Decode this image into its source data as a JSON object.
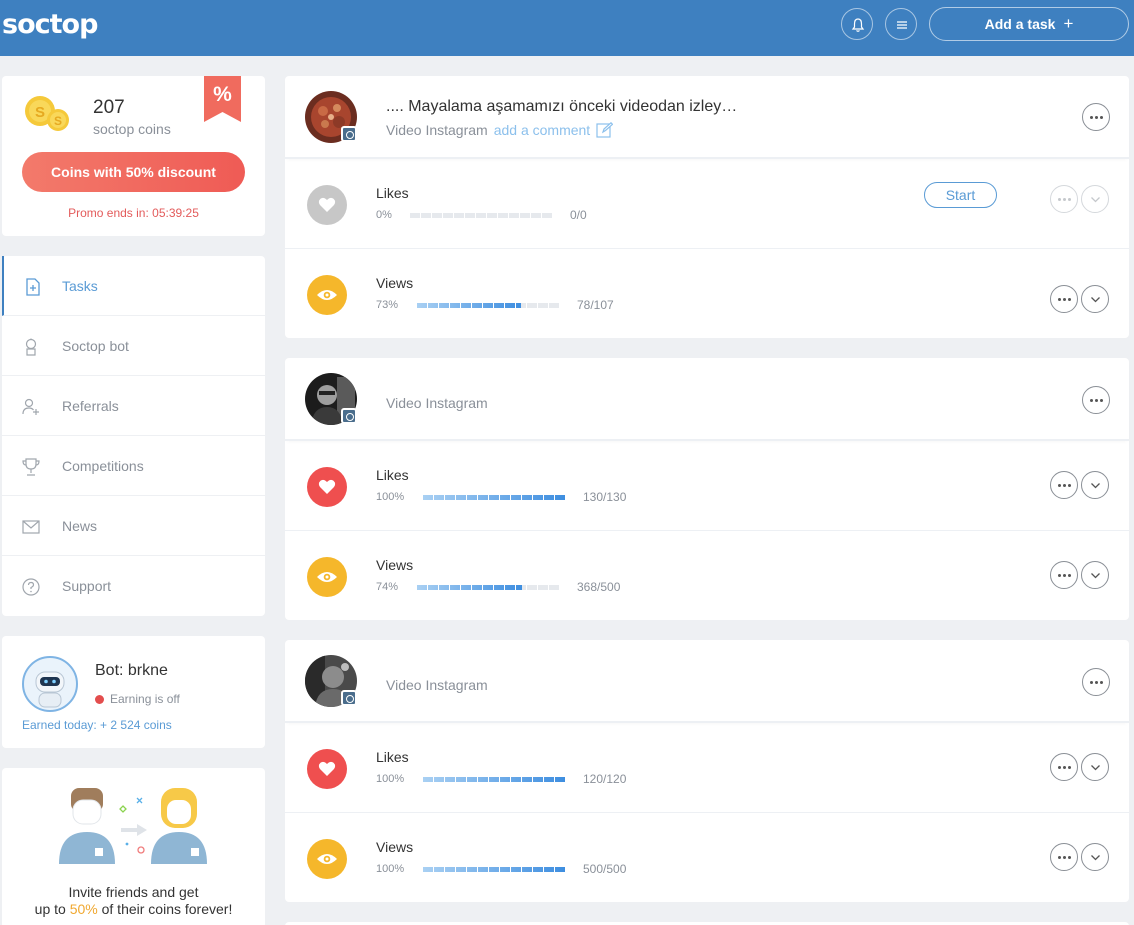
{
  "header": {
    "logo": "soctop",
    "add_task_label": "Add a task",
    "add_task_icon": "+"
  },
  "coins": {
    "count": "207",
    "label": "soctop coins",
    "badge": "%",
    "discount_button": "Coins with 50% discount",
    "promo_text": "Promo ends in: 05:39:25"
  },
  "nav": {
    "items": [
      {
        "label": "Tasks",
        "icon": "task-icon",
        "active": true
      },
      {
        "label": "Soctop bot",
        "icon": "robot-icon"
      },
      {
        "label": "Referrals",
        "icon": "user-add-icon"
      },
      {
        "label": "Competitions",
        "icon": "trophy-icon"
      },
      {
        "label": "News",
        "icon": "mail-icon"
      },
      {
        "label": "Support",
        "icon": "help-icon"
      }
    ]
  },
  "bot": {
    "name": "Bot: brkne",
    "status": "Earning is off",
    "earned": "Earned today: + 2 524 coins"
  },
  "invite": {
    "line1": "Invite friends and get",
    "line2_pre": "up to ",
    "line2_hl": "50%",
    "line2_post": " of their coins forever!"
  },
  "tasks": [
    {
      "title": ".... Mayalama aşamamızı önceki videodan izley…",
      "type": "Video Instagram",
      "comment_link": "add a comment",
      "stats": [
        {
          "label": "Likes",
          "percent_text": "0%",
          "progress": 0,
          "count": "0/0",
          "action": "Start"
        },
        {
          "label": "Views",
          "percent_text": "73%",
          "progress": 0.73,
          "count": "78/107"
        }
      ]
    },
    {
      "title": "",
      "type": "Video Instagram",
      "stats": [
        {
          "label": "Likes",
          "percent_text": "100%",
          "progress": 1.0,
          "count": "130/130"
        },
        {
          "label": "Views",
          "percent_text": "74%",
          "progress": 0.74,
          "count": "368/500"
        }
      ]
    },
    {
      "title": "",
      "type": "Video Instagram",
      "stats": [
        {
          "label": "Likes",
          "percent_text": "100%",
          "progress": 1.0,
          "count": "120/120"
        },
        {
          "label": "Views",
          "percent_text": "100%",
          "progress": 1.0,
          "count": "500/500"
        }
      ]
    }
  ],
  "colors": {
    "header_bg": "#3e80c0",
    "accent": "#5a9bd5",
    "likes_active": "#ef4f4f",
    "likes_inactive": "#c7c7c7",
    "views": "#f5b72b",
    "discount_button": "#ef5b55"
  }
}
